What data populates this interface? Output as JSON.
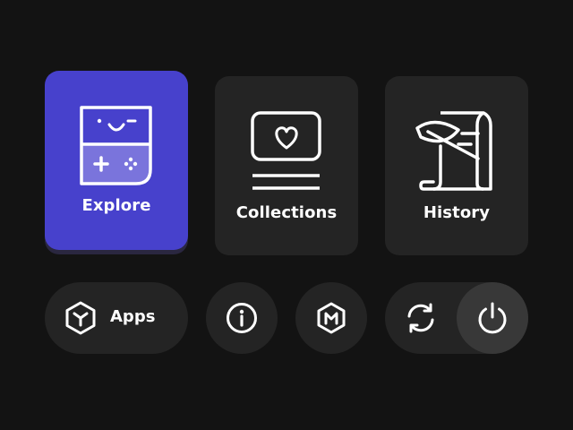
{
  "tiles": {
    "explore": {
      "label": "Explore",
      "icon": "game-console-icon",
      "color": "#4741cc"
    },
    "collections": {
      "label": "Collections",
      "icon": "heart-screen-icon"
    },
    "history": {
      "label": "History",
      "icon": "scroll-quill-icon"
    }
  },
  "bottom_bar": {
    "apps": {
      "label": "Apps",
      "icon": "apps-hexagon-icon"
    },
    "info": {
      "icon": "info-icon"
    },
    "m": {
      "icon": "m-hexagon-icon"
    },
    "sync": {
      "icon": "sync-icon"
    },
    "power": {
      "icon": "power-icon"
    }
  },
  "colors": {
    "background": "#131313",
    "tile": "#242424",
    "accent": "#4741cc",
    "power_highlight": "#383838"
  }
}
